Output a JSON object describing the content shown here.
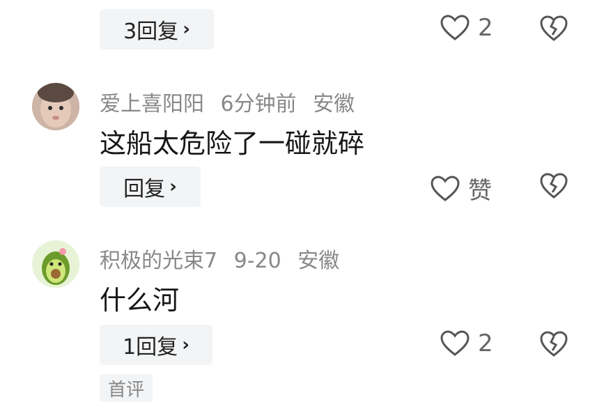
{
  "comments": [
    {
      "reply_label": "3回复",
      "like_label": "2"
    },
    {
      "username": "爱上喜阳阳",
      "time": "6分钟前",
      "location": "安徽",
      "text": "这船太危险了一碰就碎",
      "reply_label": "回复",
      "like_label": "赞"
    },
    {
      "username": "积极的光束7",
      "time": "9-20",
      "location": "安徽",
      "text": "什么河",
      "reply_label": "1回复",
      "like_label": "2"
    }
  ],
  "footer_partial_label": "首评",
  "icons": {
    "reply_chevron": "chevron-right-icon",
    "like": "heart-outline-icon",
    "dislike": "broken-heart-icon"
  },
  "colors": {
    "meta": "#888888",
    "button_bg": "#f3f4f6",
    "icon": "#555555"
  }
}
